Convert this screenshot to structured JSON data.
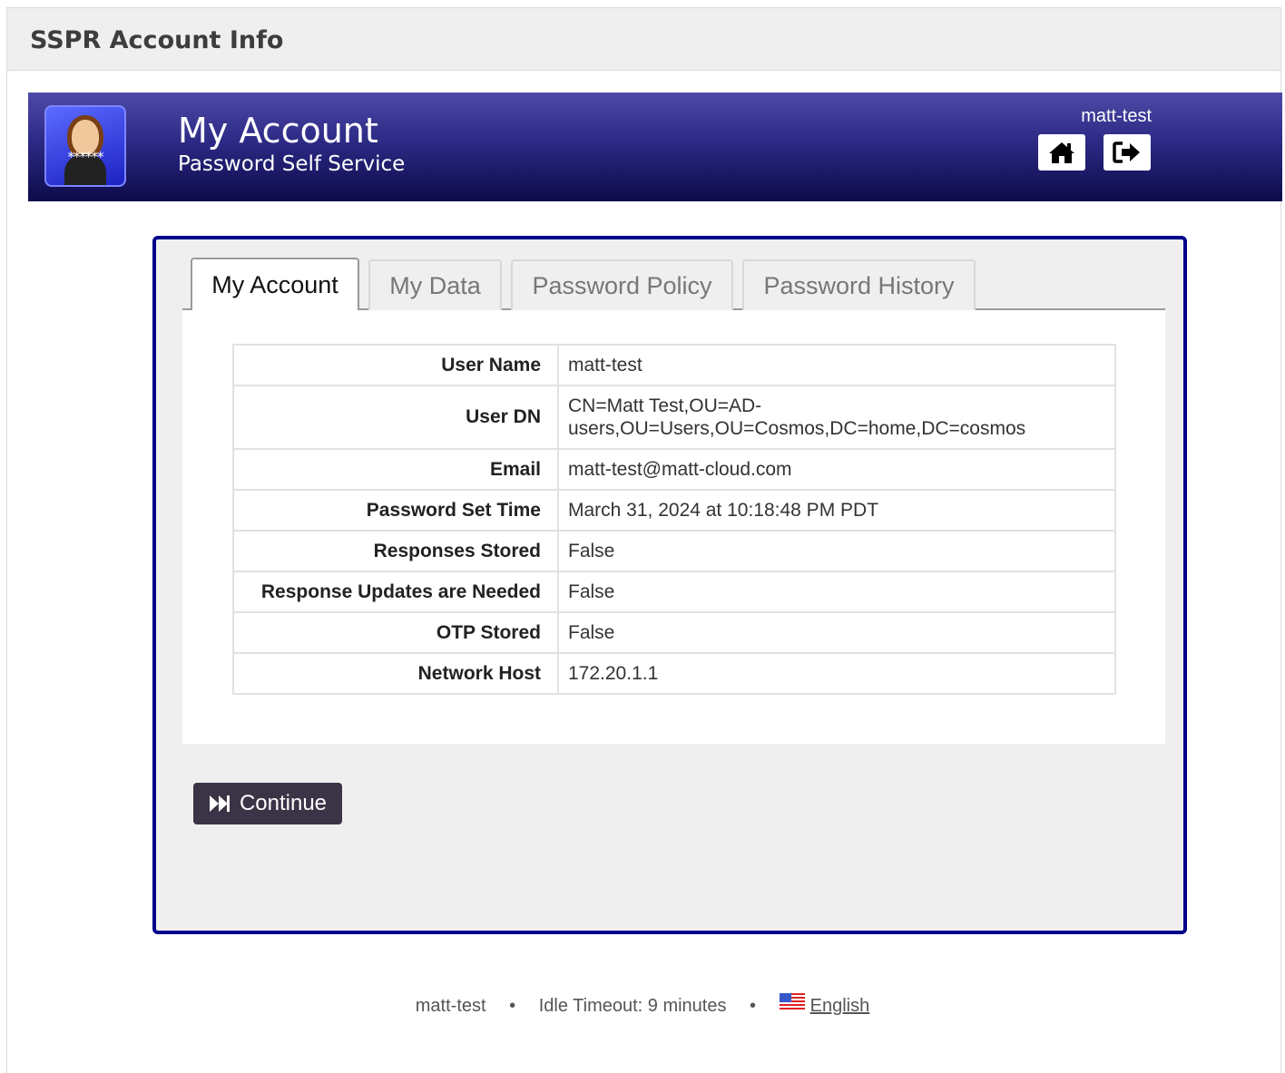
{
  "app": {
    "title": "SSPR Account Info"
  },
  "header": {
    "title": "My Account",
    "subtitle": "Password Self Service",
    "username": "matt-test",
    "logo_text": "******"
  },
  "tabs": [
    {
      "label": "My Account",
      "active": true
    },
    {
      "label": "My Data",
      "active": false
    },
    {
      "label": "Password Policy",
      "active": false
    },
    {
      "label": "Password History",
      "active": false
    }
  ],
  "account_info": [
    {
      "key": "User Name",
      "value": "matt-test"
    },
    {
      "key": "User DN",
      "value": "CN=Matt Test,OU=AD-users,OU=Users,OU=Cosmos,DC=home,DC=cosmos"
    },
    {
      "key": "Email",
      "value": "matt-test@matt-cloud.com"
    },
    {
      "key": "Password Set Time",
      "value": "March 31, 2024 at 10:18:48 PM PDT"
    },
    {
      "key": "Responses Stored",
      "value": "False"
    },
    {
      "key": "Response Updates are Needed",
      "value": "False"
    },
    {
      "key": "OTP Stored",
      "value": "False"
    },
    {
      "key": "Network Host",
      "value": "172.20.1.1"
    }
  ],
  "continue_label": "Continue",
  "footer": {
    "username": "matt-test",
    "separator": "•",
    "idle_timeout": "Idle Timeout: 9 minutes",
    "language": "English"
  },
  "colors": {
    "header_gradient_top": "#4e4aa8",
    "header_gradient_bottom": "#0d0b4a",
    "content_border": "#00008b",
    "continue_button": "#3b3346"
  },
  "icons": [
    "home-icon",
    "logout-icon",
    "fast-forward-icon",
    "us-flag-icon"
  ]
}
